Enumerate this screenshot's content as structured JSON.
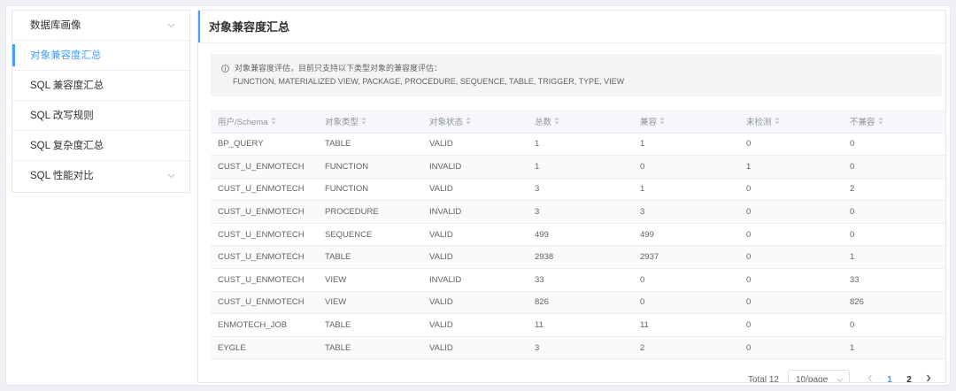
{
  "sidebar": {
    "items": [
      {
        "label": "数据库画像",
        "has_chevron": true
      },
      {
        "label": "对象兼容度汇总",
        "active": true
      },
      {
        "label": "SQL 兼容度汇总"
      },
      {
        "label": "SQL 改写规则"
      },
      {
        "label": "SQL 复杂度汇总"
      },
      {
        "label": "SQL 性能对比",
        "has_chevron": true
      }
    ]
  },
  "main": {
    "title": "对象兼容度汇总",
    "notice": {
      "line1": "对象兼容度评估，目前只支持以下类型对象的兼容度评估：",
      "line2": "FUNCTION, MATERIALIZED VIEW, PACKAGE, PROCEDURE, SEQUENCE, TABLE, TRIGGER, TYPE, VIEW"
    },
    "table": {
      "columns": [
        "用户/Schema",
        "对象类型",
        "对象状态",
        "总数",
        "兼容",
        "未检测",
        "不兼容"
      ],
      "rows": [
        [
          "BP_QUERY",
          "TABLE",
          "VALID",
          "1",
          "1",
          "0",
          "0"
        ],
        [
          "CUST_U_ENMOTECH",
          "FUNCTION",
          "INVALID",
          "1",
          "0",
          "1",
          "0"
        ],
        [
          "CUST_U_ENMOTECH",
          "FUNCTION",
          "VALID",
          "3",
          "1",
          "0",
          "2"
        ],
        [
          "CUST_U_ENMOTECH",
          "PROCEDURE",
          "INVALID",
          "3",
          "3",
          "0",
          "0"
        ],
        [
          "CUST_U_ENMOTECH",
          "SEQUENCE",
          "VALID",
          "499",
          "499",
          "0",
          "0"
        ],
        [
          "CUST_U_ENMOTECH",
          "TABLE",
          "VALID",
          "2938",
          "2937",
          "0",
          "1"
        ],
        [
          "CUST_U_ENMOTECH",
          "VIEW",
          "INVALID",
          "33",
          "0",
          "0",
          "33"
        ],
        [
          "CUST_U_ENMOTECH",
          "VIEW",
          "VALID",
          "826",
          "0",
          "0",
          "826"
        ],
        [
          "ENMOTECH_JOB",
          "TABLE",
          "VALID",
          "11",
          "11",
          "0",
          "0"
        ],
        [
          "EYGLE",
          "TABLE",
          "VALID",
          "3",
          "2",
          "0",
          "1"
        ]
      ]
    },
    "pagination": {
      "total_label": "Total 12",
      "page_size": "10/page",
      "pages": [
        "1",
        "2"
      ],
      "current_page": "1"
    }
  },
  "colors": {
    "accent": "#409eff",
    "border": "#ebeef5",
    "header_bg": "#f5f7fa"
  }
}
